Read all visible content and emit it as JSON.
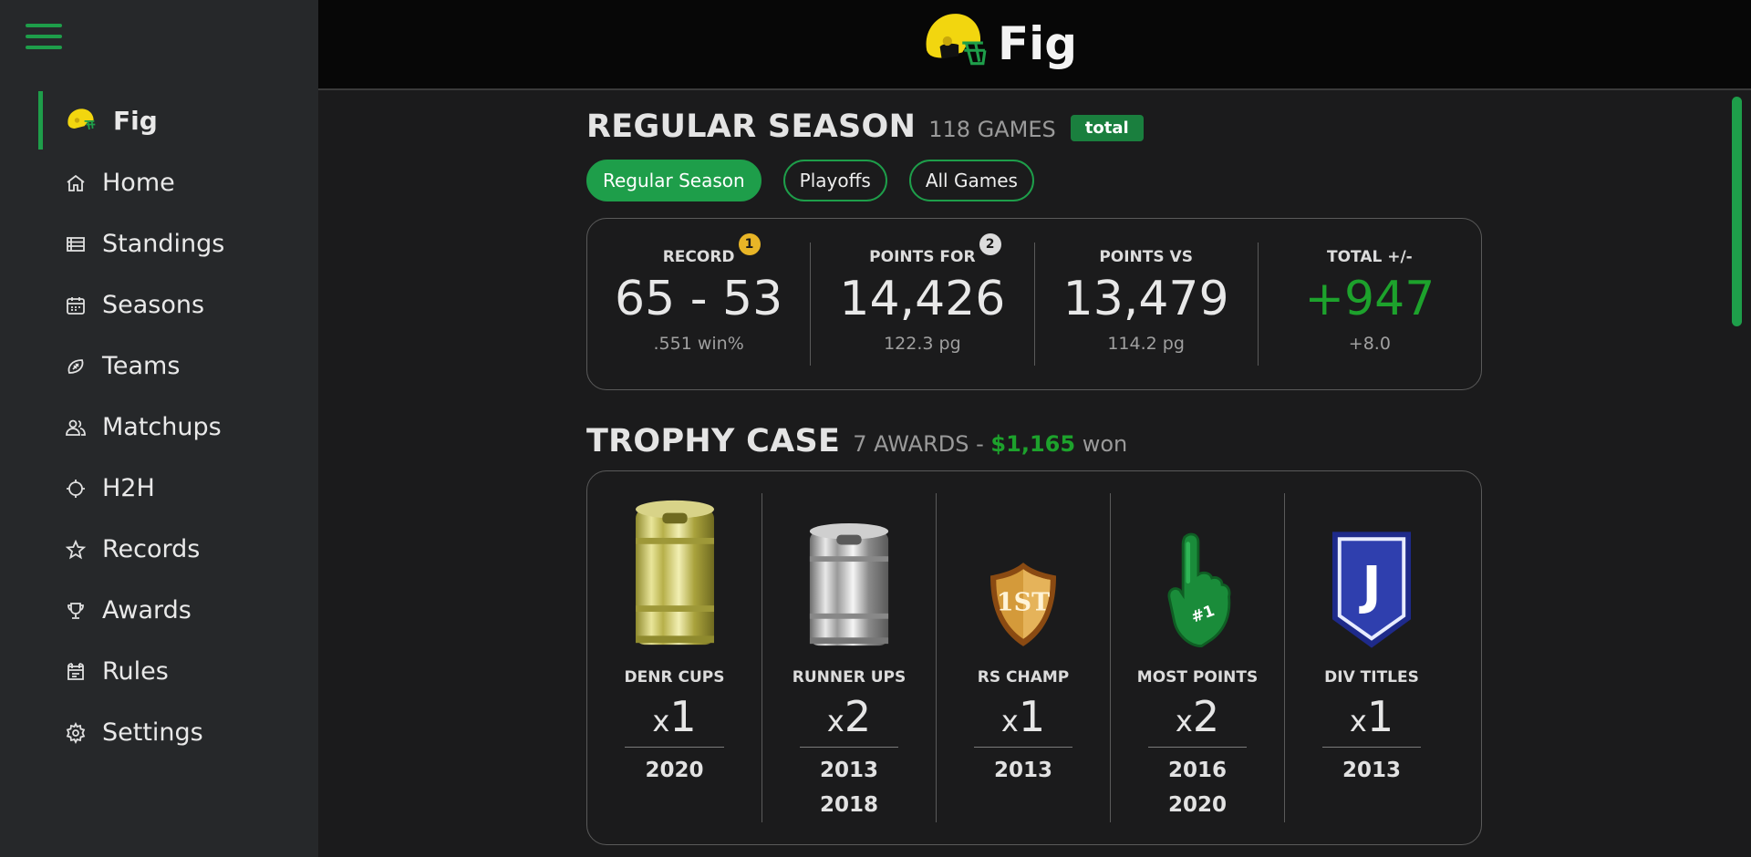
{
  "app": {
    "title": "Fig",
    "accent": "#1e9e4a",
    "helmet_color": "#f2d60f"
  },
  "sidebar": {
    "menu_icon": "hamburger-icon",
    "items": [
      {
        "label": "Fig",
        "icon": "helmet-icon",
        "active": true
      },
      {
        "label": "Home",
        "icon": "home-icon"
      },
      {
        "label": "Standings",
        "icon": "list-icon"
      },
      {
        "label": "Seasons",
        "icon": "calendar-icon"
      },
      {
        "label": "Teams",
        "icon": "football-icon"
      },
      {
        "label": "Matchups",
        "icon": "users-icon"
      },
      {
        "label": "H2H",
        "icon": "crosshair-icon"
      },
      {
        "label": "Records",
        "icon": "star-icon"
      },
      {
        "label": "Awards",
        "icon": "trophy-icon"
      },
      {
        "label": "Rules",
        "icon": "rules-icon"
      },
      {
        "label": "Settings",
        "icon": "gear-icon"
      }
    ]
  },
  "season": {
    "title": "REGULAR SEASON",
    "games": "118 GAMES",
    "badge": "total",
    "filters": [
      "Regular Season",
      "Playoffs",
      "All Games"
    ],
    "active_filter": "Regular Season"
  },
  "stats": [
    {
      "label": "RECORD",
      "value": "65 - 53",
      "sub": ".551 win%",
      "note": "1"
    },
    {
      "label": "POINTS FOR",
      "value": "14,426",
      "sub": "122.3 pg",
      "note": "2"
    },
    {
      "label": "POINTS VS",
      "value": "13,479",
      "sub": "114.2 pg"
    },
    {
      "label": "TOTAL +/-",
      "value": "+947",
      "sub": "+8.0",
      "positive": true
    }
  ],
  "trophy_case": {
    "title": "TROPHY CASE",
    "awards": "7 AWARDS -",
    "money": "$1,165",
    "won": "won",
    "trophies": [
      {
        "name": "DENR CUPS",
        "x": "x",
        "count": "1",
        "years": [
          "2020"
        ],
        "icon": "gold-keg-icon"
      },
      {
        "name": "RUNNER UPS",
        "x": "x",
        "count": "2",
        "years": [
          "2013",
          "2018"
        ],
        "icon": "silver-keg-icon"
      },
      {
        "name": "RS CHAMP",
        "x": "x",
        "count": "1",
        "years": [
          "2013"
        ],
        "icon": "first-place-shield-icon",
        "shield_text": "1ST"
      },
      {
        "name": "MOST POINTS",
        "x": "x",
        "count": "2",
        "years": [
          "2016",
          "2020"
        ],
        "icon": "foam-finger-icon",
        "finger_text": "#1"
      },
      {
        "name": "DIV TITLES",
        "x": "x",
        "count": "1",
        "years": [
          "2013"
        ],
        "icon": "division-banner-icon",
        "banner_text": "J"
      }
    ]
  }
}
